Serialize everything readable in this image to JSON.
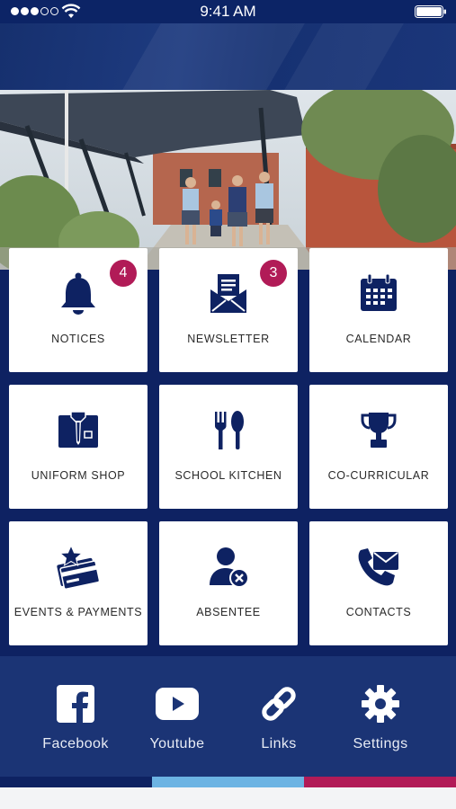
{
  "status_bar": {
    "time": "9:41 AM"
  },
  "tiles": [
    {
      "id": "notices",
      "label": "NOTICES",
      "badge": "4",
      "icon": "bell-icon"
    },
    {
      "id": "newsletter",
      "label": "NEWSLETTER",
      "badge": "3",
      "icon": "envelope-open-icon"
    },
    {
      "id": "calendar",
      "label": "CALENDAR",
      "badge": null,
      "icon": "calendar-icon"
    },
    {
      "id": "uniform",
      "label": "UNIFORM SHOP",
      "badge": null,
      "icon": "shirt-icon"
    },
    {
      "id": "kitchen",
      "label": "SCHOOL KITCHEN",
      "badge": null,
      "icon": "fork-spoon-icon"
    },
    {
      "id": "cocurricular",
      "label": "CO-CURRICULAR",
      "badge": null,
      "icon": "trophy-icon"
    },
    {
      "id": "events",
      "label": "EVENTS & PAYMENTS",
      "badge": null,
      "icon": "star-card-icon"
    },
    {
      "id": "absentee",
      "label": "ABSENTEE",
      "badge": null,
      "icon": "user-cancel-icon"
    },
    {
      "id": "contacts",
      "label": "CONTACTS",
      "badge": null,
      "icon": "phone-mail-icon"
    }
  ],
  "bottom_nav": [
    {
      "label": "Facebook",
      "icon": "facebook-icon"
    },
    {
      "label": "Youtube",
      "icon": "youtube-icon"
    },
    {
      "label": "Links",
      "icon": "link-icon"
    },
    {
      "label": "Settings",
      "icon": "gear-icon"
    }
  ],
  "colors": {
    "navy": "#0e2262",
    "bottom_bar": "#1b3475",
    "badge": "#b11b57",
    "icon": "#0e2262",
    "stripe_navy": "#0e2262",
    "stripe_blue": "#6cb3e3",
    "stripe_magenta": "#b11b57"
  }
}
